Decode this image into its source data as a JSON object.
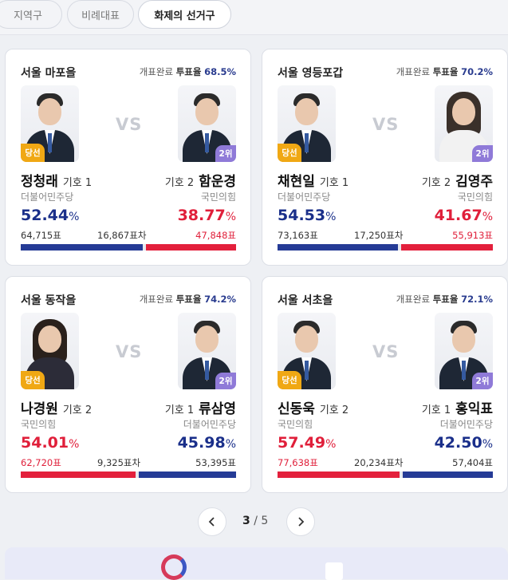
{
  "tabs": [
    "지역구",
    "비례대표",
    "화제의 선거구"
  ],
  "active_tab": 2,
  "cards": [
    {
      "region": "서울 마포을",
      "status": "개표완료",
      "turnout_label": "투표율",
      "turnout": "68.5%",
      "vs": "VS",
      "left": {
        "name": "정청래",
        "number_label": "기호 1",
        "party": "더불어민주당",
        "pct": "52.44",
        "pct_unit": "%",
        "votes": "64,715표",
        "badge": "당선",
        "color": "blue"
      },
      "right": {
        "name": "함운경",
        "number_label": "기호 2",
        "party": "국민의힘",
        "pct": "38.77",
        "pct_unit": "%",
        "votes": "47,848표",
        "badge": "2위",
        "color": "red"
      },
      "diff": "16,867표차"
    },
    {
      "region": "서울 영등포갑",
      "status": "개표완료",
      "turnout_label": "투표율",
      "turnout": "70.2%",
      "vs": "VS",
      "left": {
        "name": "채현일",
        "number_label": "기호 1",
        "party": "더불어민주당",
        "pct": "54.53",
        "pct_unit": "%",
        "votes": "73,163표",
        "badge": "당선",
        "color": "blue"
      },
      "right": {
        "name": "김영주",
        "number_label": "기호 2",
        "party": "국민의힘",
        "pct": "41.67",
        "pct_unit": "%",
        "votes": "55,913표",
        "badge": "2위",
        "color": "red"
      },
      "diff": "17,250표차"
    },
    {
      "region": "서울 동작을",
      "status": "개표완료",
      "turnout_label": "투표율",
      "turnout": "74.2%",
      "vs": "VS",
      "left": {
        "name": "나경원",
        "number_label": "기호 2",
        "party": "국민의힘",
        "pct": "54.01",
        "pct_unit": "%",
        "votes": "62,720표",
        "badge": "당선",
        "color": "red"
      },
      "right": {
        "name": "류삼영",
        "number_label": "기호 1",
        "party": "더불어민주당",
        "pct": "45.98",
        "pct_unit": "%",
        "votes": "53,395표",
        "badge": "2위",
        "color": "blue"
      },
      "diff": "9,325표차"
    },
    {
      "region": "서울 서초을",
      "status": "개표완료",
      "turnout_label": "투표율",
      "turnout": "72.1%",
      "vs": "VS",
      "left": {
        "name": "신동욱",
        "number_label": "기호 2",
        "party": "국민의힘",
        "pct": "57.49",
        "pct_unit": "%",
        "votes": "77,638표",
        "badge": "당선",
        "color": "red"
      },
      "right": {
        "name": "홍익표",
        "number_label": "기호 1",
        "party": "더불어민주당",
        "pct": "42.50",
        "pct_unit": "%",
        "votes": "57,404표",
        "badge": "2위",
        "color": "blue"
      },
      "diff": "20,234표차"
    }
  ],
  "pagination": {
    "current": "3",
    "separator": "/",
    "total": "5"
  },
  "colors": {
    "blue": "#1a2f8a",
    "red": "#e01f3a",
    "bar_blue": "#253b96",
    "bar_red": "#e3203c",
    "win_badge": "#f0a814",
    "rank_badge": "#8f7ad8"
  }
}
